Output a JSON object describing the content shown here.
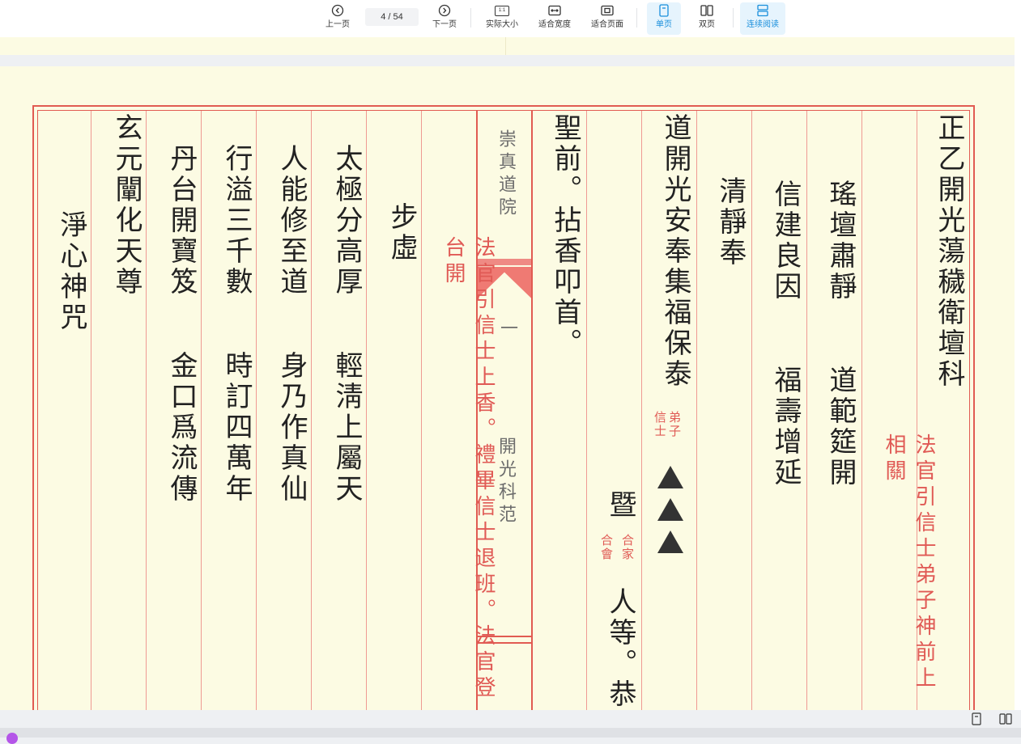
{
  "toolbar": {
    "prev_label": "上一页",
    "page_indicator": "4  /  54",
    "next_label": "下一页",
    "actual_size_label": "实际大小",
    "actual_size_icon_text": "1:1",
    "fit_width_label": "适合宽度",
    "fit_page_label": "适合页面",
    "single_page_label": "单页",
    "double_page_label": "双页",
    "continuous_label": "连续阅读",
    "accent_color": "#1a8fdc"
  },
  "document": {
    "col_title": "正乙開光蕩穢衛壇科",
    "col_red_right": "法官引信士弟子神前上相關",
    "col_yaotan": "瑤壇肅靜",
    "col_daofan": "道範筵開",
    "col_xinjian": "信建良因",
    "col_fushou": "福壽增延",
    "col_qingjing": "清靜奉",
    "col_daokai": "道開光安奉集福保泰",
    "note_dizi": "弟子",
    "note_xinshi": "信士",
    "col_ji": "暨",
    "note_hejia": "合家",
    "note_hehui": "合會",
    "col_renden": "人等。恭",
    "col_shengqian": "聖前。拈香叩首。",
    "center_top": "崇真道院",
    "center_num": "一",
    "center_bottom": "開光科范",
    "col_red_left": "法官引信士上香。禮畢信士退班。法官登台開",
    "col_buxu": "步虛",
    "col_taiji": "太極分高厚",
    "col_qingqing": "輕淸上屬天",
    "col_renneng": "人能修至道",
    "col_shennai": "身乃作真仙",
    "col_xingyi": "行溢三千數",
    "col_shiding": "時訂四萬年",
    "col_dantai": "丹台開寶笈",
    "col_jinkou": "金口爲流傳",
    "col_xuanyuan": "玄元闡化天尊",
    "col_jingxin": "淨心神咒"
  },
  "icons": {
    "prev": "chevron-left-circle-icon",
    "next": "chevron-right-circle-icon",
    "actual_size": "actual-size-icon",
    "fit_width": "fit-width-icon",
    "fit_page": "fit-page-icon",
    "single_page": "single-page-icon",
    "double_page": "double-page-icon",
    "continuous": "continuous-scroll-icon"
  },
  "colors": {
    "paper": "#fcfbe3",
    "red_ink": "#e05a55"
  }
}
